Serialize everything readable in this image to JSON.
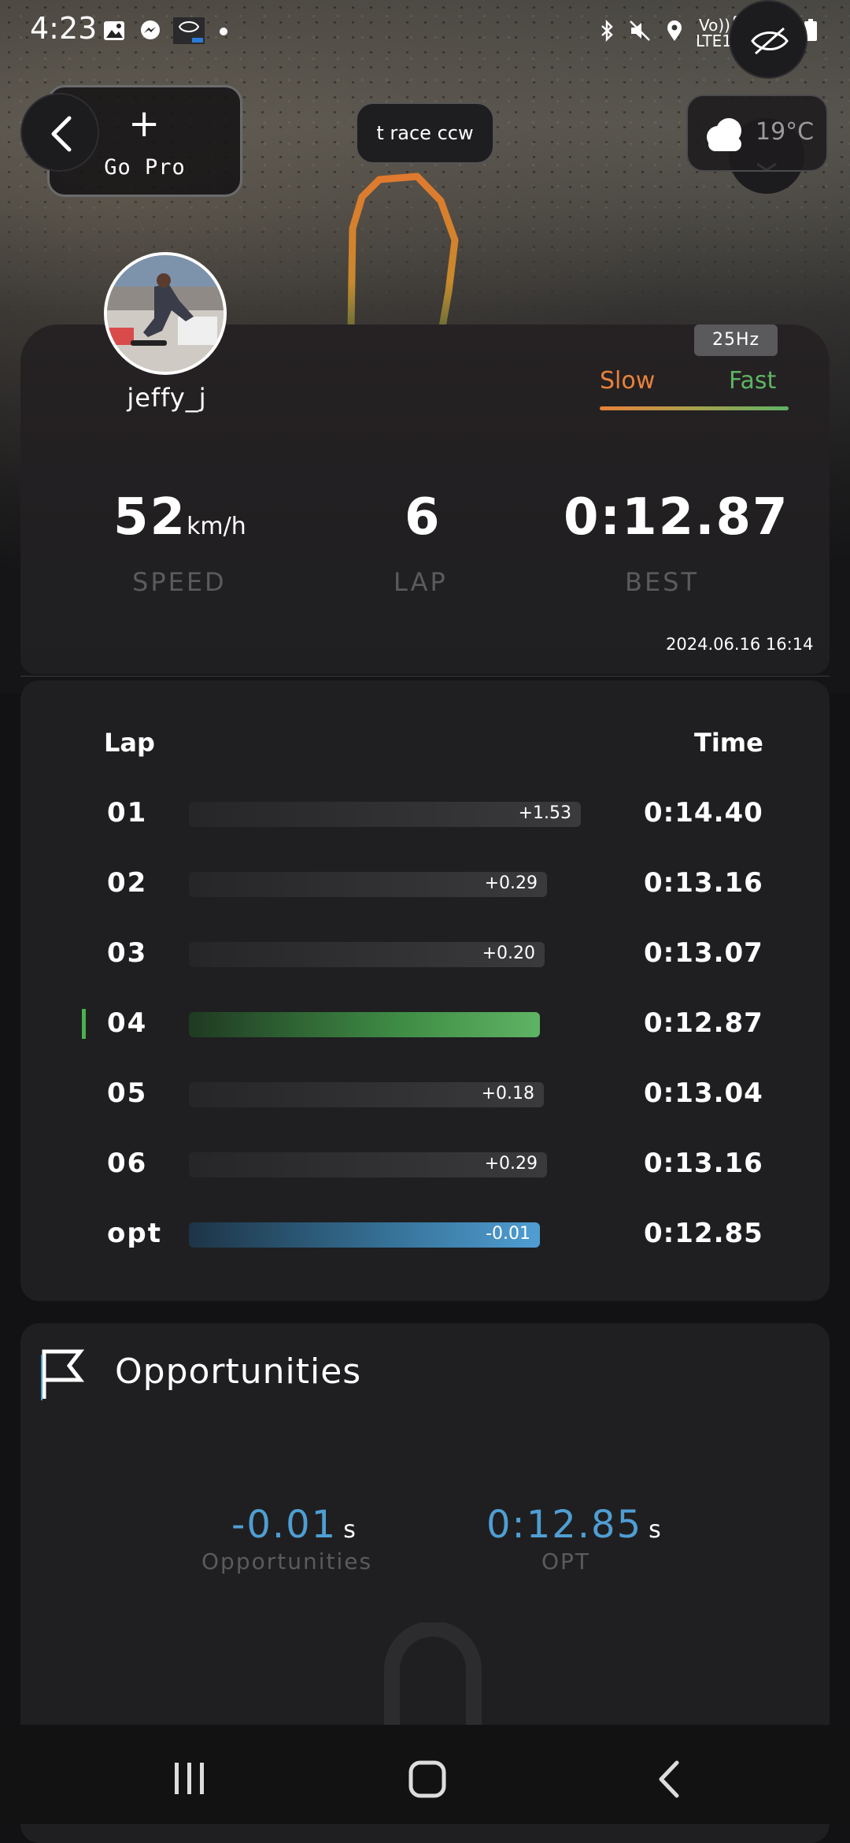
{
  "status_bar": {
    "time": "4:23",
    "network_top": "Vo))",
    "network_bottom": "LTE1",
    "badge_5g": "5G",
    "icons": [
      "gallery-icon",
      "messenger-icon",
      "app-icon",
      "dot-icon",
      "bluetooth-icon",
      "mute-icon",
      "location-icon",
      "signal-icon",
      "battery-icon"
    ]
  },
  "hero": {
    "gopro_label": "Go Pro",
    "track_name": "t race ccw",
    "temperature": "19°C"
  },
  "profile": {
    "username": "jeffy_j",
    "rate": "25Hz",
    "legend_slow": "Slow",
    "legend_fast": "Fast",
    "colors": {
      "slow": "#e9823a",
      "fast": "#5fb364",
      "opt": "#4f9ed3"
    }
  },
  "stats": {
    "speed_value": "52",
    "speed_unit": "km/h",
    "speed_label": "SPEED",
    "lap_value": "6",
    "lap_label": "LAP",
    "best_value": "0:12.87",
    "best_label": "BEST",
    "date": "2024.06.16 16:14"
  },
  "laps": {
    "header_lap": "Lap",
    "header_time": "Time",
    "rows": [
      {
        "lap": "01",
        "diff": "+1.53",
        "time": "0:14.40",
        "seconds": 14.4,
        "kind": "normal"
      },
      {
        "lap": "02",
        "diff": "+0.29",
        "time": "0:13.16",
        "seconds": 13.16,
        "kind": "normal"
      },
      {
        "lap": "03",
        "diff": "+0.20",
        "time": "0:13.07",
        "seconds": 13.07,
        "kind": "normal"
      },
      {
        "lap": "04",
        "diff": "",
        "time": "0:12.87",
        "seconds": 12.87,
        "kind": "best"
      },
      {
        "lap": "05",
        "diff": "+0.18",
        "time": "0:13.04",
        "seconds": 13.04,
        "kind": "normal"
      },
      {
        "lap": "06",
        "diff": "+0.29",
        "time": "0:13.16",
        "seconds": 13.16,
        "kind": "normal"
      },
      {
        "lap": "opt",
        "diff": "-0.01",
        "time": "0:12.85",
        "seconds": 12.85,
        "kind": "opt"
      }
    ]
  },
  "opportunities": {
    "title": "Opportunities",
    "opp_value": "-0.01",
    "opp_unit": "s",
    "opp_label": "Opportunities",
    "opt_value": "0:12.85",
    "opt_unit": "s",
    "opt_label": "OPT"
  },
  "nav": {
    "icons": [
      "recent-apps-icon",
      "home-icon",
      "back-icon"
    ]
  }
}
